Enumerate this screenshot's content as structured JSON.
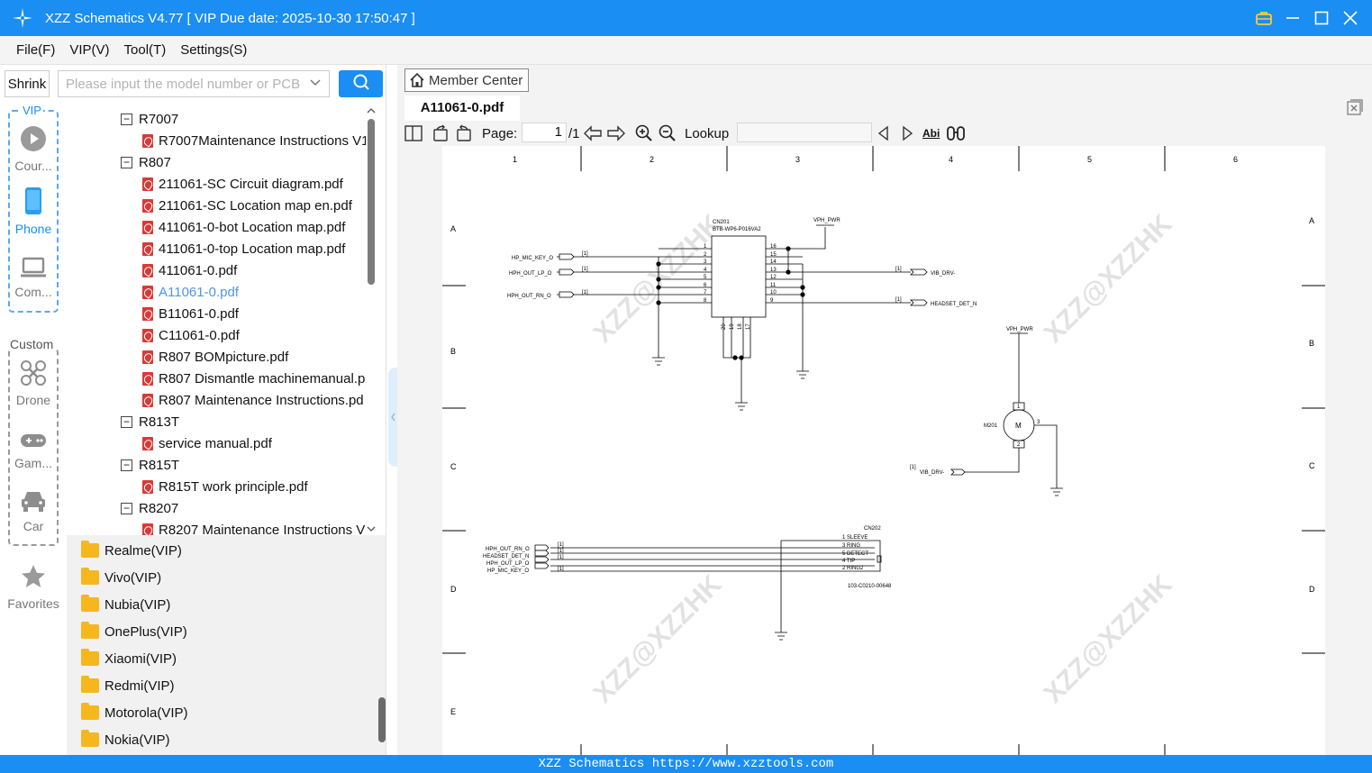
{
  "app": {
    "title": "XZZ Schematics V4.77 [ VIP Due date: 2025-10-30 17:50:47 ]"
  },
  "menu": [
    "File(F)",
    "VIP(V)",
    "Tool(T)",
    "Settings(S)"
  ],
  "left": {
    "shrink_label": "Shrink",
    "search_placeholder": "Please input the model number or PCB",
    "vip_label": "VIP",
    "custom_label": "Custom",
    "categories": [
      {
        "label": "Cour...",
        "icon": "play-icon"
      },
      {
        "label": "Phone",
        "icon": "phone-icon"
      },
      {
        "label": "Com...",
        "icon": "laptop-icon"
      },
      {
        "label": "Drone",
        "icon": "drone-icon"
      },
      {
        "label": "Gam...",
        "icon": "gamepad-icon"
      },
      {
        "label": "Car",
        "icon": "car-icon"
      },
      {
        "label": "Favorites",
        "icon": "star-icon"
      }
    ],
    "tree": [
      {
        "type": "folder",
        "label": "R7007"
      },
      {
        "type": "file",
        "label": "R7007Maintenance Instructions V1"
      },
      {
        "type": "folder",
        "label": "R807"
      },
      {
        "type": "file",
        "label": "211061-SC Circuit diagram.pdf"
      },
      {
        "type": "file",
        "label": "211061-SC Location map en.pdf"
      },
      {
        "type": "file",
        "label": "411061-0-bot Location map.pdf"
      },
      {
        "type": "file",
        "label": "411061-0-top Location map.pdf"
      },
      {
        "type": "file",
        "label": "411061-0.pdf"
      },
      {
        "type": "file",
        "label": "A11061-0.pdf",
        "selected": true
      },
      {
        "type": "file",
        "label": "B11061-0.pdf"
      },
      {
        "type": "file",
        "label": "C11061-0.pdf"
      },
      {
        "type": "file",
        "label": "R807 BOMpicture.pdf"
      },
      {
        "type": "file",
        "label": "R807 Dismantle machinemanual.p"
      },
      {
        "type": "file",
        "label": "R807 Maintenance Instructions.pd"
      },
      {
        "type": "folder",
        "label": "R813T"
      },
      {
        "type": "file",
        "label": "service manual.pdf"
      },
      {
        "type": "folder",
        "label": "R815T"
      },
      {
        "type": "file",
        "label": "R815T work principle.pdf"
      },
      {
        "type": "folder",
        "label": "R8207"
      },
      {
        "type": "file",
        "label": "R8207 Maintenance Instructions V"
      }
    ],
    "brands": [
      "Realme(VIP)",
      "Vivo(VIP)",
      "Nubia(VIP)",
      "OnePlus(VIP)",
      "Xiaomi(VIP)",
      "Redmi(VIP)",
      "Motorola(VIP)",
      "Nokia(VIP)"
    ]
  },
  "viewer": {
    "member_center": "Member Center",
    "tab_title": "A11061-0.pdf",
    "page_label": "Page:",
    "page_current": "1",
    "page_total": "/1",
    "lookup_label": "Lookup",
    "abi_label": "Abi",
    "schematic": {
      "columns": [
        "1",
        "2",
        "3",
        "4",
        "5",
        "6"
      ],
      "rows": [
        "A",
        "B",
        "C",
        "D",
        "E"
      ],
      "cn201_ref": "CN201",
      "cn201_part": "BTB-WP6-P016VA2",
      "cn201_left_pins": [
        "1",
        "2",
        "3",
        "4",
        "5",
        "6",
        "7",
        "8"
      ],
      "cn201_right_pins": [
        "16",
        "15",
        "14",
        "13",
        "12",
        "11",
        "10",
        "9"
      ],
      "cn201_bottom_pins": [
        "20",
        "19",
        "18",
        "17"
      ],
      "vph_pwr": "VPH_PWR",
      "hp_mic_key": "HP_MIC_KEY_O",
      "hph_out_lp": "HPH_OUT_LP_O",
      "hph_out_rn": "HPH_OUT_RN_O",
      "vib_drv": "VIB_DRV-",
      "headset_det": "HEADSET_DET_N",
      "sheet_ref": "[1]",
      "m201_ref": "M201",
      "m201_pins": [
        "1",
        "2",
        "3"
      ],
      "m201_symbol": "M",
      "cn202_ref": "CN202",
      "cn202_part": "103-C0210-00648",
      "cn202_signals": [
        "HPH_OUT_RN_O",
        "HEADSET_DET_N",
        "HPH_OUT_LP_O",
        "HP_MIC_KEY_O"
      ],
      "cn202_pins": [
        "1  SLEEVE",
        "3  RING",
        "5  DETECT",
        "4  TIP",
        "2  RING2"
      ],
      "watermark": "XZZ@XZZHK"
    }
  },
  "status_text": "XZZ Schematics https://www.xzztools.com",
  "colors": {
    "accent": "#1a8ef3",
    "pdf_red": "#d83a36",
    "folder": "#f6b71e",
    "selected_text": "#4d95ea"
  }
}
